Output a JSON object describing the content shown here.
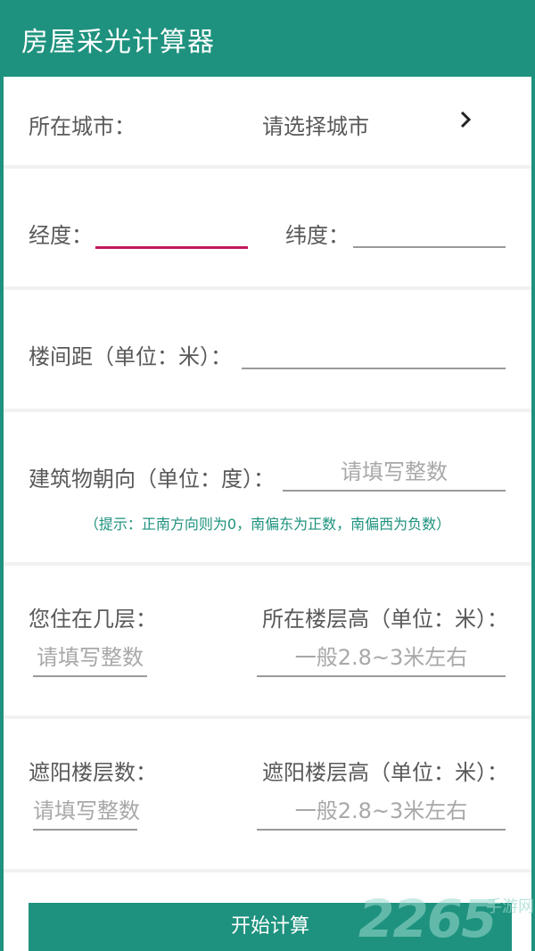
{
  "app": {
    "title": "房屋采光计算器"
  },
  "city": {
    "label": "所在城市：",
    "value": "请选择城市"
  },
  "coords": {
    "longitude_label": "经度：",
    "latitude_label": "纬度："
  },
  "spacing": {
    "label": "楼间距（单位：米）："
  },
  "orientation": {
    "label": "建筑物朝向（单位：度）：",
    "placeholder": "请填写整数",
    "hint": "（提示：正南方向则为0，南偏东为正数，南偏西为负数）"
  },
  "your_floor": {
    "label": "您住在几层：",
    "placeholder": "请填写整数"
  },
  "floor_height": {
    "label": "所在楼层高（单位：米）：",
    "placeholder": "一般2.8~3米左右"
  },
  "shade_floors": {
    "label": "遮阳楼层数：",
    "placeholder": "请填写整数"
  },
  "shade_height": {
    "label": "遮阳楼层高（单位：米）：",
    "placeholder": "一般2.8~3米左右"
  },
  "action": {
    "start_label": "开始计算"
  },
  "watermark": {
    "number": "2265",
    "suffix": "手游网"
  },
  "colors": {
    "primary": "#1e927e",
    "focus_underline": "#c2185b"
  }
}
